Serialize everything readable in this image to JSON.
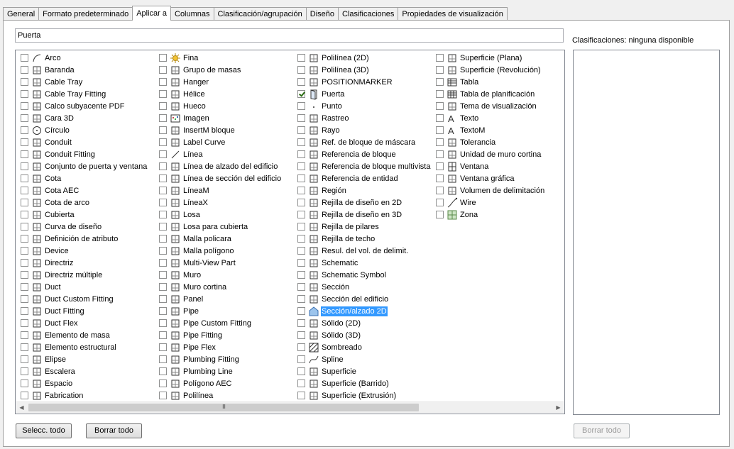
{
  "tabs": [
    "General",
    "Formato predeterminado",
    "Aplicar a",
    "Columnas",
    "Clasificación/agrupación",
    "Diseño",
    "Clasificaciones",
    "Propiedades de visualización"
  ],
  "active_tab": "Aplicar a",
  "name_field": {
    "value": "Puerta"
  },
  "classifications": {
    "label": "Clasificaciones: ninguna disponible"
  },
  "columns": [
    [
      {
        "label": "Arco",
        "icon": "arc-icon",
        "checked": false
      },
      {
        "label": "Baranda",
        "icon": "railing-icon",
        "checked": false
      },
      {
        "label": "Cable Tray",
        "icon": "cable-tray-icon",
        "checked": false
      },
      {
        "label": "Cable Tray Fitting",
        "icon": "cable-tray-fitting-icon",
        "checked": false
      },
      {
        "label": "Calco subyacente PDF",
        "icon": "pdf-underlay-icon",
        "checked": false
      },
      {
        "label": "Cara 3D",
        "icon": "face-3d-icon",
        "checked": false
      },
      {
        "label": "Círculo",
        "icon": "circle-icon",
        "checked": false
      },
      {
        "label": "Conduit",
        "icon": "conduit-icon",
        "checked": false
      },
      {
        "label": "Conduit Fitting",
        "icon": "conduit-fitting-icon",
        "checked": false
      },
      {
        "label": "Conjunto de puerta y ventana",
        "icon": "door-window-assembly-icon",
        "checked": false
      },
      {
        "label": "Cota",
        "icon": "dimension-icon",
        "checked": false
      },
      {
        "label": "Cota AEC",
        "icon": "aec-dimension-icon",
        "checked": false
      },
      {
        "label": "Cota de arco",
        "icon": "arc-dimension-icon",
        "checked": false
      },
      {
        "label": "Cubierta",
        "icon": "roof-icon",
        "checked": false
      },
      {
        "label": "Curva de diseño",
        "icon": "layout-curve-icon",
        "checked": false
      },
      {
        "label": "Definición de atributo",
        "icon": "attribute-definition-icon",
        "checked": false
      },
      {
        "label": "Device",
        "icon": "device-icon",
        "checked": false
      },
      {
        "label": "Directriz",
        "icon": "leader-icon",
        "checked": false
      },
      {
        "label": "Directriz múltiple",
        "icon": "multileader-icon",
        "checked": false
      },
      {
        "label": "Duct",
        "icon": "duct-icon",
        "checked": false
      },
      {
        "label": "Duct Custom Fitting",
        "icon": "duct-custom-fitting-icon",
        "checked": false
      },
      {
        "label": "Duct Fitting",
        "icon": "duct-fitting-icon",
        "checked": false
      },
      {
        "label": "Duct Flex",
        "icon": "duct-flex-icon",
        "checked": false
      },
      {
        "label": "Elemento de masa",
        "icon": "mass-element-icon",
        "checked": false
      },
      {
        "label": "Elemento estructural",
        "icon": "structural-member-icon",
        "checked": false
      },
      {
        "label": "Elipse",
        "icon": "ellipse-icon",
        "checked": false
      },
      {
        "label": "Escalera",
        "icon": "stair-icon",
        "checked": false
      },
      {
        "label": "Espacio",
        "icon": "space-icon",
        "checked": false
      },
      {
        "label": "Fabrication",
        "icon": "fabrication-icon",
        "checked": false
      }
    ],
    [
      {
        "label": "Fina",
        "icon": "light-icon",
        "checked": false
      },
      {
        "label": "Grupo de masas",
        "icon": "mass-group-icon",
        "checked": false
      },
      {
        "label": "Hanger",
        "icon": "hanger-icon",
        "checked": false
      },
      {
        "label": "Hélice",
        "icon": "helix-icon",
        "checked": false
      },
      {
        "label": "Hueco",
        "icon": "opening-icon",
        "checked": false
      },
      {
        "label": "Imagen",
        "icon": "image-icon",
        "checked": false
      },
      {
        "label": "InsertM bloque",
        "icon": "minsert-block-icon",
        "checked": false
      },
      {
        "label": "Label Curve",
        "icon": "label-curve-icon",
        "checked": false
      },
      {
        "label": "Línea",
        "icon": "line-icon",
        "checked": false
      },
      {
        "label": "Línea de alzado del edificio",
        "icon": "elevation-line-icon",
        "checked": false
      },
      {
        "label": "Línea de sección del edificio",
        "icon": "section-line-icon",
        "checked": false
      },
      {
        "label": "LíneaM",
        "icon": "mline-icon",
        "checked": false
      },
      {
        "label": "LíneaX",
        "icon": "xline-icon",
        "checked": false
      },
      {
        "label": "Losa",
        "icon": "slab-icon",
        "checked": false
      },
      {
        "label": "Losa para cubierta",
        "icon": "roof-slab-icon",
        "checked": false
      },
      {
        "label": "Malla policara",
        "icon": "polyface-mesh-icon",
        "checked": false
      },
      {
        "label": "Malla polígono",
        "icon": "polygon-mesh-icon",
        "checked": false
      },
      {
        "label": "Multi-View Part",
        "icon": "multiview-part-icon",
        "checked": false
      },
      {
        "label": "Muro",
        "icon": "wall-icon",
        "checked": false
      },
      {
        "label": "Muro cortina",
        "icon": "curtain-wall-icon",
        "checked": false
      },
      {
        "label": "Panel",
        "icon": "panel-icon",
        "checked": false
      },
      {
        "label": "Pipe",
        "icon": "pipe-icon",
        "checked": false
      },
      {
        "label": "Pipe Custom Fitting",
        "icon": "pipe-custom-fitting-icon",
        "checked": false
      },
      {
        "label": "Pipe Fitting",
        "icon": "pipe-fitting-icon",
        "checked": false
      },
      {
        "label": "Pipe Flex",
        "icon": "pipe-flex-icon",
        "checked": false
      },
      {
        "label": "Plumbing Fitting",
        "icon": "plumbing-fitting-icon",
        "checked": false
      },
      {
        "label": "Plumbing Line",
        "icon": "plumbing-line-icon",
        "checked": false
      },
      {
        "label": "Polígono AEC",
        "icon": "aec-polygon-icon",
        "checked": false
      },
      {
        "label": "Polilínea",
        "icon": "polyline-icon",
        "checked": false
      }
    ],
    [
      {
        "label": "Polilínea (2D)",
        "icon": "polyline-2d-icon",
        "checked": false
      },
      {
        "label": "Polilínea (3D)",
        "icon": "polyline-3d-icon",
        "checked": false
      },
      {
        "label": "POSITIONMARKER",
        "icon": "position-marker-icon",
        "checked": false
      },
      {
        "label": "Puerta",
        "icon": "door-icon",
        "checked": true
      },
      {
        "label": "Punto",
        "icon": "point-icon",
        "checked": false
      },
      {
        "label": "Rastreo",
        "icon": "trace-icon",
        "checked": false
      },
      {
        "label": "Rayo",
        "icon": "ray-icon",
        "checked": false
      },
      {
        "label": "Ref. de bloque de máscara",
        "icon": "mask-block-ref-icon",
        "checked": false
      },
      {
        "label": "Referencia de bloque",
        "icon": "block-reference-icon",
        "checked": false
      },
      {
        "label": "Referencia de bloque multivista",
        "icon": "multiview-block-ref-icon",
        "checked": false
      },
      {
        "label": "Referencia de entidad",
        "icon": "entity-reference-icon",
        "checked": false
      },
      {
        "label": "Región",
        "icon": "region-icon",
        "checked": false
      },
      {
        "label": "Rejilla de diseño en 2D",
        "icon": "layout-grid-2d-icon",
        "checked": false
      },
      {
        "label": "Rejilla de diseño en 3D",
        "icon": "layout-grid-3d-icon",
        "checked": false
      },
      {
        "label": "Rejilla de pilares",
        "icon": "column-grid-icon",
        "checked": false
      },
      {
        "label": "Rejilla de techo",
        "icon": "ceiling-grid-icon",
        "checked": false
      },
      {
        "label": "Resul. del vol. de delimit.",
        "icon": "bounding-volume-result-icon",
        "checked": false
      },
      {
        "label": "Schematic",
        "icon": "schematic-icon",
        "checked": false
      },
      {
        "label": "Schematic Symbol",
        "icon": "schematic-symbol-icon",
        "checked": false
      },
      {
        "label": "Sección",
        "icon": "section-icon",
        "checked": false
      },
      {
        "label": "Sección del edificio",
        "icon": "building-section-icon",
        "checked": false
      },
      {
        "label": "Sección/alzado 2D",
        "icon": "section-elevation-2d-icon",
        "checked": false,
        "selected": true
      },
      {
        "label": "Sólido (2D)",
        "icon": "solid-2d-icon",
        "checked": false
      },
      {
        "label": "Sólido (3D)",
        "icon": "solid-3d-icon",
        "checked": false
      },
      {
        "label": "Sombreado",
        "icon": "hatch-icon",
        "checked": false
      },
      {
        "label": "Spline",
        "icon": "spline-icon",
        "checked": false
      },
      {
        "label": "Superficie",
        "icon": "surface-icon",
        "checked": false
      },
      {
        "label": "Superficie (Barrido)",
        "icon": "swept-surface-icon",
        "checked": false
      },
      {
        "label": "Superficie (Extrusión)",
        "icon": "extruded-surface-icon",
        "checked": false
      }
    ],
    [
      {
        "label": "Superficie (Plana)",
        "icon": "planar-surface-icon",
        "checked": false
      },
      {
        "label": "Superficie (Revolución)",
        "icon": "revolved-surface-icon",
        "checked": false
      },
      {
        "label": "Tabla",
        "icon": "table-icon",
        "checked": false
      },
      {
        "label": "Tabla de planificación",
        "icon": "schedule-table-icon",
        "checked": false
      },
      {
        "label": "Tema de visualización",
        "icon": "display-theme-icon",
        "checked": false
      },
      {
        "label": "Texto",
        "icon": "text-icon",
        "checked": false
      },
      {
        "label": "TextoM",
        "icon": "mtext-icon",
        "checked": false
      },
      {
        "label": "Tolerancia",
        "icon": "tolerance-icon",
        "checked": false
      },
      {
        "label": "Unidad de muro cortina",
        "icon": "curtain-wall-unit-icon",
        "checked": false
      },
      {
        "label": "Ventana",
        "icon": "window-icon",
        "checked": false
      },
      {
        "label": "Ventana gráfica",
        "icon": "viewport-icon",
        "checked": false
      },
      {
        "label": "Volumen de delimitación",
        "icon": "bounding-volume-icon",
        "checked": false
      },
      {
        "label": "Wire",
        "icon": "wire-icon",
        "checked": false
      },
      {
        "label": "Zona",
        "icon": "zone-icon",
        "checked": false
      }
    ]
  ],
  "buttons": {
    "select_all": "Selecc. todo",
    "clear_all": "Borrar todo",
    "clear_classifications": "Borrar todo"
  },
  "scrollbar": {
    "grip": "III"
  }
}
